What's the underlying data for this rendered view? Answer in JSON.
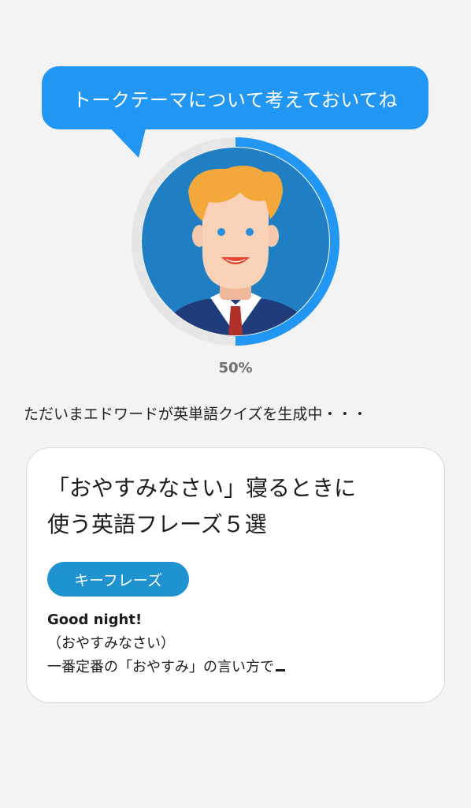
{
  "speech_bubble": {
    "text": "トークテーマについて考えておいてね"
  },
  "progress": {
    "value": 0.5,
    "label": "50%"
  },
  "status": {
    "text": "ただいまエドワードが英単語クイズを生成中・・・"
  },
  "card": {
    "title_line1": "「おやすみなさい」寝るときに",
    "title_line2": "使う英語フレーズ５選",
    "tag_label": "キーフレーズ",
    "phrase_en": "Good night!",
    "phrase_ja": "（おやすみなさい）",
    "phrase_note": "一番定番の「おやすみ」の言い方で"
  },
  "colors": {
    "bubble": "#2196f3",
    "progress_arc": "#2196f3",
    "progress_track": "#e6e6e6",
    "avatar_bg": "#1f7fc2",
    "tag": "#1f93d0"
  },
  "icons": {
    "avatar": "man-with-orange-hair-avatar"
  }
}
